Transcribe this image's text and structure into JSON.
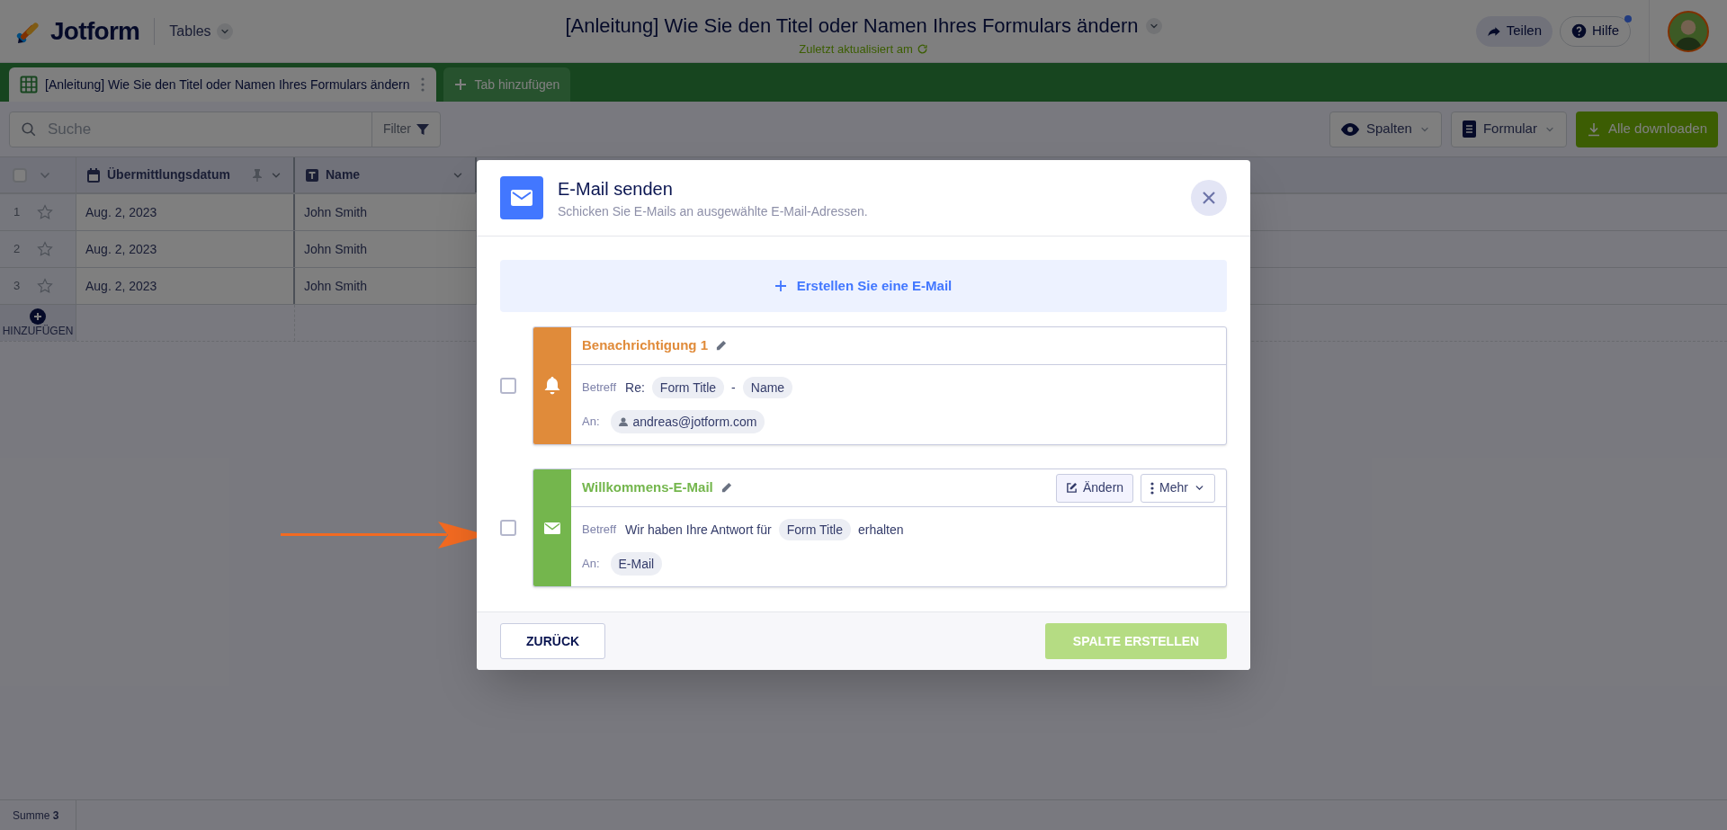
{
  "header": {
    "logo": "Jotform",
    "product": "Tables",
    "title": "[Anleitung] Wie Sie den Titel oder Namen Ihres Formulars ändern",
    "subtitle": "Zuletzt aktualisiert am",
    "buttons": [
      {
        "kind": "share",
        "label": "Teilen"
      },
      {
        "kind": "help",
        "label": "Hilfe"
      }
    ]
  },
  "tabs": [
    {
      "label": "[Anleitung] Wie Sie den Titel oder Namen Ihres Formulars ändern",
      "selected": true
    }
  ],
  "add_tab": "Tab hinzufügen",
  "toolbar": {
    "search": {
      "placeholder": "Suche"
    },
    "filter": "Filter",
    "buttons": [
      {
        "kind": "columns",
        "label": "Spalten"
      },
      {
        "kind": "form",
        "label": "Formular"
      },
      {
        "kind": "download",
        "label": "Alle downloaden"
      }
    ]
  },
  "table": {
    "select_all_checked": false,
    "columns": [
      {
        "kind": "date",
        "label": "Übermittlungsdatum"
      },
      {
        "kind": "text",
        "label": "Name"
      }
    ],
    "rows": [
      {
        "number": "1",
        "starred": false,
        "cells": [
          "Aug. 2, 2023",
          "John Smith"
        ]
      },
      {
        "number": "2",
        "starred": false,
        "cells": [
          "Aug. 2, 2023",
          "John Smith"
        ]
      },
      {
        "number": "3",
        "starred": false,
        "cells": [
          "Aug. 2, 2023",
          "John Smith"
        ]
      }
    ],
    "add_row": "HINZUFÜGEN",
    "summary": "Summe **3**"
  },
  "modal": {
    "title": "E-Mail senden",
    "subtitle": "Schicken Sie E-Mails an ausgewählte E-Mail-Adressen.",
    "create_button": "Erstellen Sie eine E-Mail",
    "emails": [
      {
        "kind": "notification",
        "name": "Benachrichtigung 1",
        "color": "#e08b3a",
        "checked": false,
        "subject_label": "Betreff",
        "subject": [
          {
            "kind": "text",
            "text": "Re:"
          },
          {
            "kind": "tag",
            "text": "Form Title"
          },
          {
            "kind": "text",
            "text": "-"
          },
          {
            "kind": "tag",
            "text": "Name"
          }
        ],
        "to_label": "An:",
        "recipients": [
          {
            "kind": "user",
            "text": "andreas@jotform.com"
          }
        ]
      },
      {
        "kind": "autoresponder",
        "name": "Willkommens-E-Mail",
        "color": "#74b64d",
        "checked": false,
        "subject_label": "Betreff",
        "subject": [
          {
            "kind": "text",
            "text": "Wir haben Ihre Antwort für"
          },
          {
            "kind": "tag",
            "text": "Form Title"
          },
          {
            "kind": "text",
            "text": "erhalten"
          }
        ],
        "to_label": "An:",
        "recipients": [
          {
            "kind": "field",
            "text": "E-Mail"
          }
        ],
        "actions": [
          {
            "kind": "edit",
            "label": "Ändern"
          },
          {
            "kind": "more",
            "label": "Mehr"
          }
        ]
      }
    ],
    "back_button": "ZURÜCK",
    "submit_button": {
      "label": "SPALTE ERSTELLEN",
      "disabled": true
    }
  }
}
